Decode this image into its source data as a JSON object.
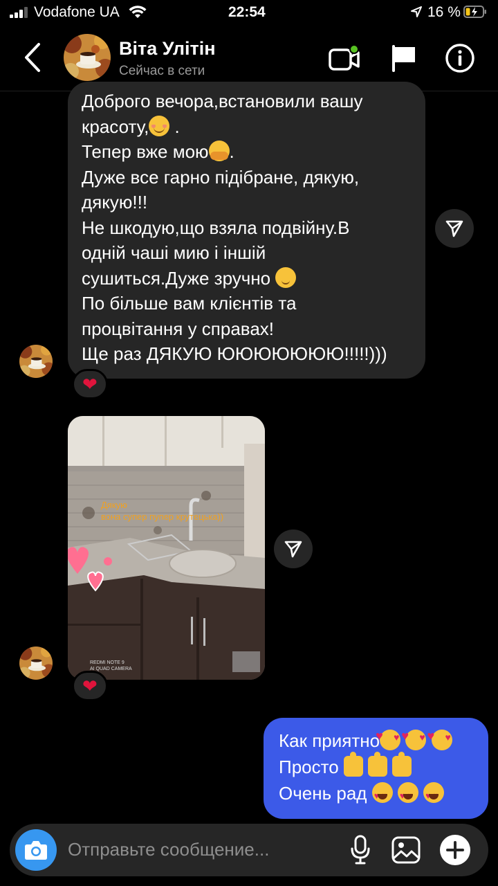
{
  "status_bar": {
    "carrier": "Vodafone UA",
    "time": "22:54",
    "battery_percent": "16 %"
  },
  "header": {
    "contact_name": "Віта Улітін",
    "contact_status": "Сейчас в сети"
  },
  "messages": {
    "incoming_text_lines": [
      "Доброго вечора,встановили вашу",
      "красоту,",
      "Тепер вже мою",
      "Дуже все гарно підібране, дякую,",
      "дякую!!!",
      "Не шкодую,що взяла подвійну.В",
      "одній чаші мию і іншій",
      "сушиться.Дуже зручно",
      "По більше вам клієнтів та",
      "процвітання у справах!",
      "Ще раз ДЯКУЮ ЮЮЮЮЮЮЮ!!!!!)))"
    ],
    "reaction_emoji": "❤",
    "photo_caption_line1": "Дякую",
    "photo_caption_line2": "вона супер пупер крутецька))",
    "photo_camera_tag_line1": "REDMI NOTE 9",
    "photo_camera_tag_line2": "AI QUAD CAMERA",
    "outgoing_lines": [
      "Как приятно",
      "Просто",
      "Очень рад"
    ]
  },
  "composer": {
    "placeholder": "Отправьте сообщение..."
  },
  "colors": {
    "background": "#000000",
    "incoming_bubble": "#262626",
    "outgoing_bubble": "#3c5ae8",
    "camera_button": "#3797f0",
    "online_dot": "#58c322"
  }
}
